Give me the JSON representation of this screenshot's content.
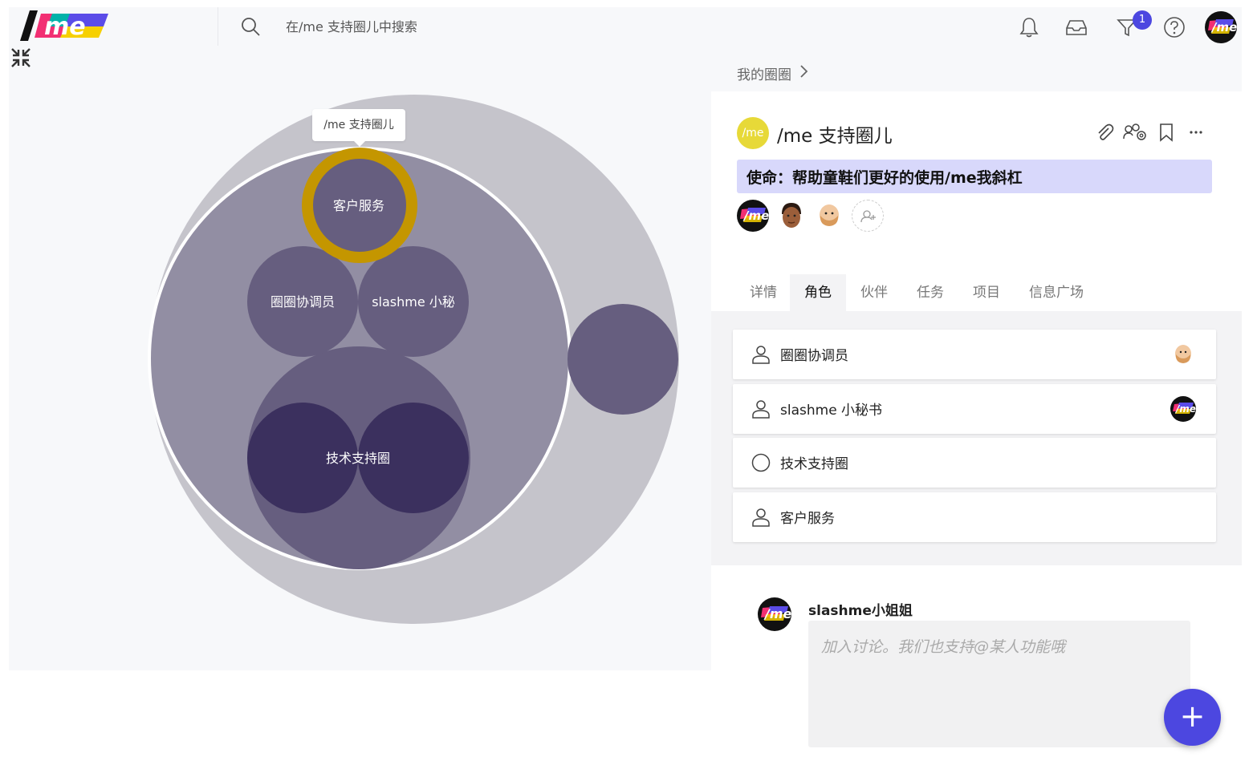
{
  "search": {
    "placeholder": "在/me 支持圈儿中搜索"
  },
  "topbar": {
    "notification_count": "1",
    "logo_text": "/me"
  },
  "viz": {
    "tooltip": "/me 支持圈儿",
    "nodes": {
      "customer_service": "客户服务",
      "coordinator": "圈圈协调员",
      "secretary": "slashme 小秘",
      "tech_support": "技术支持圈"
    }
  },
  "breadcrumb": {
    "label": "我的圈圈"
  },
  "circle": {
    "logo_text": "/me",
    "title": "/me 支持圈儿",
    "mission": "使命：帮助童鞋们更好的使用/me我斜杠"
  },
  "tabs": [
    "详情",
    "角色",
    "伙伴",
    "任务",
    "项目",
    "信息广场"
  ],
  "active_tab": "角色",
  "roles": [
    {
      "label": "圈圈协调员",
      "icon": "person-icon"
    },
    {
      "label": "slashme 小秘书",
      "icon": "person-icon"
    },
    {
      "label": "技术支持圈",
      "icon": "circle-icon"
    },
    {
      "label": "客户服务",
      "icon": "person-icon"
    }
  ],
  "comment": {
    "author": "slashme小姐姐",
    "placeholder": "加入讨论。我们也支持@某人功能哦"
  },
  "fab": {
    "label": "+"
  },
  "colors": {
    "accent": "#4c47e0",
    "mission_bg": "#d8d8fb",
    "highlight_ring": "#c49600",
    "circle_logo": "#e7d938"
  }
}
